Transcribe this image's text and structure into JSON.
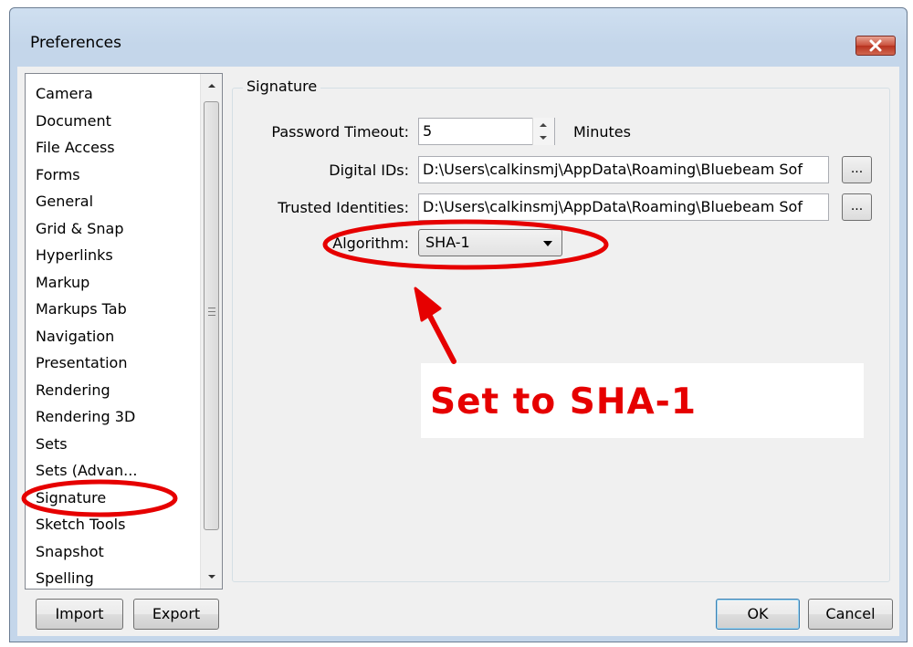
{
  "window": {
    "title": "Preferences"
  },
  "categories": [
    "Camera",
    "Document",
    "File Access",
    "Forms",
    "General",
    "Grid & Snap",
    "Hyperlinks",
    "Markup",
    "Markups Tab",
    "Navigation",
    "Presentation",
    "Rendering",
    "Rendering 3D",
    "Sets",
    "Sets (Advan...",
    "Signature",
    "Sketch Tools",
    "Snapshot",
    "Spelling"
  ],
  "selected_category": "Signature",
  "group": {
    "title": "Signature"
  },
  "fields": {
    "password_timeout_label": "Password Timeout:",
    "password_timeout_value": "5",
    "password_timeout_unit": "Minutes",
    "digital_ids_label": "Digital IDs:",
    "digital_ids_value": "D:\\Users\\calkinsmj\\AppData\\Roaming\\Bluebeam Sof",
    "trusted_identities_label": "Trusted Identities:",
    "trusted_identities_value": "D:\\Users\\calkinsmj\\AppData\\Roaming\\Bluebeam Sof",
    "browse_label": "...",
    "algorithm_label": "Algorithm:",
    "algorithm_value": "SHA-1"
  },
  "buttons": {
    "import": "Import",
    "export": "Export",
    "ok": "OK",
    "cancel": "Cancel"
  },
  "annotation": {
    "text": "Set to SHA-1",
    "color": "#e60000"
  },
  "icons": [
    "close-icon",
    "scroll-up-icon",
    "scroll-down-icon",
    "spin-up-icon",
    "spin-down-icon",
    "dropdown-arrow-icon"
  ]
}
